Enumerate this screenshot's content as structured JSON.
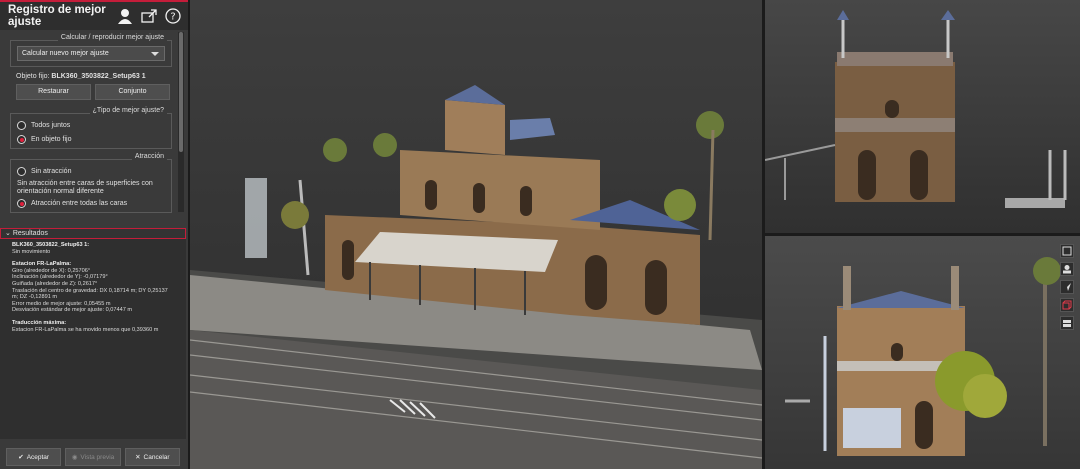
{
  "panel": {
    "title": "Registro de mejor ajuste",
    "icons": [
      "user-icon",
      "export-icon",
      "help-icon"
    ],
    "calc_group": {
      "legend": "Calcular / reproducir mejor ajuste",
      "select_value": "Calcular nuevo mejor ajuste"
    },
    "fixed_object_label": "Objeto fijo:",
    "fixed_object_value": "BLK360_3503822_Setup63 1",
    "restore_button": "Restaurar",
    "set_button": "Conjunto",
    "type_group": {
      "legend": "¿Tipo de mejor ajuste?",
      "options": [
        "Todos juntos",
        "En objeto fijo"
      ],
      "selected": 1
    },
    "attraction_group": {
      "legend": "Atracción",
      "options": [
        "Sin atracción",
        "Atracción entre todas las caras"
      ],
      "description": "Sin atracción entre caras de superficies con orientación normal diferente",
      "selected": 1
    },
    "results": {
      "header": "Resultados",
      "object_title": "BLK360_3503822_Setup63 1:",
      "movement": "Sin movimiento",
      "station_title": "Estacion FR-LaPalma:",
      "lines": [
        "Giro (alrededor de X): 0,25706°",
        "Inclinación (alrededor de Y): -0,07179°",
        "Guiñada (alrededor de Z): 0,2617°",
        "Traslación del centro de gravedad: DX 0,18714 m; DY 0,25137",
        "m; DZ -0,12891 m",
        "Error medio de mejor ajuste: 0,05455 m",
        "Desviación estándar de mejor ajuste: 0,07447 m"
      ],
      "max_translation_title": "Traducción máxima:",
      "max_translation_text": "Estacion FR-LaPalma se ha movido menos que 0,39360 m"
    },
    "footer": {
      "accept": "Aceptar",
      "preview": "Vista previa",
      "cancel": "Cancelar"
    }
  },
  "colors": {
    "accent": "#c41d3a",
    "panel_bg": "#3a3a3a",
    "viewport_bg": "#333333"
  }
}
